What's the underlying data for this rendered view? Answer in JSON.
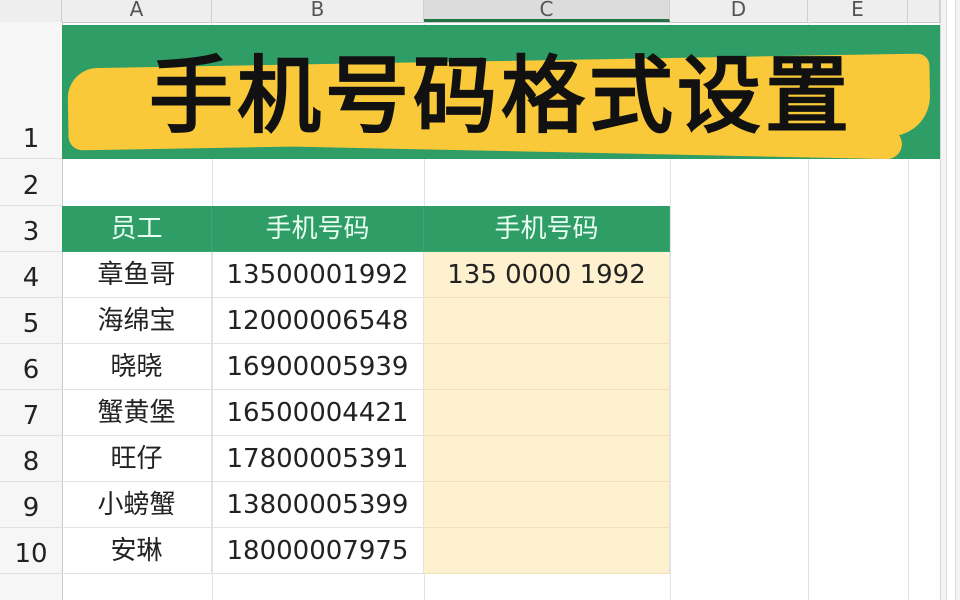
{
  "column_headers": [
    "A",
    "B",
    "C",
    "D",
    "E"
  ],
  "selected_column": "C",
  "row_headers": [
    "1",
    "2",
    "3",
    "4",
    "5",
    "6",
    "7",
    "8",
    "9",
    "10"
  ],
  "title": "手机号码格式设置",
  "table": {
    "headers": [
      "员工",
      "手机号码",
      "手机号码"
    ],
    "rows": [
      [
        "章鱼哥",
        "13500001992",
        "135 0000 1992"
      ],
      [
        "海绵宝",
        "12000006548",
        ""
      ],
      [
        "晓晓",
        "16900005939",
        ""
      ],
      [
        "蟹黄堡",
        "16500004421",
        ""
      ],
      [
        "旺仔",
        "17800005391",
        ""
      ],
      [
        "小螃蟹",
        "13800005399",
        ""
      ],
      [
        "安琳",
        "18000007975",
        ""
      ]
    ]
  },
  "colors": {
    "header_green": "#2f9d66",
    "highlight_yellow": "#f9c93a",
    "result_fill": "#fdf1cf"
  }
}
